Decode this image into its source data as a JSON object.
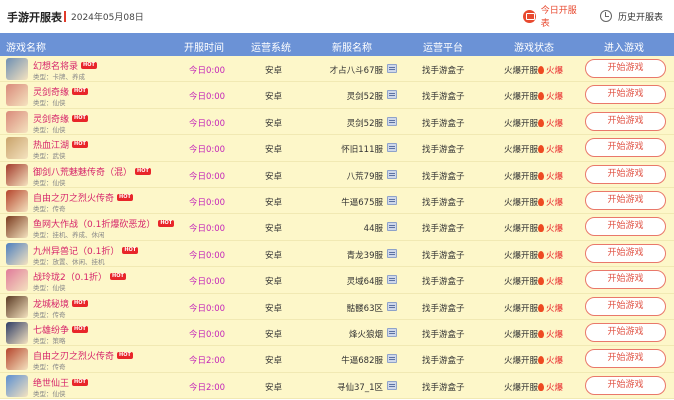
{
  "header": {
    "title": "手游开服表",
    "date": "2024年05月08日",
    "today_label": "今日开服表",
    "history_label": "历史开服表",
    "today_icon": "calendar-icon",
    "history_icon": "clock-icon"
  },
  "columns": [
    "游戏名称",
    "开服时间",
    "运营系统",
    "新服名称",
    "运营平台",
    "游戏状态",
    "进入游戏"
  ],
  "colors": {
    "accent": "#e8492f",
    "header_bg": "#6b92d6",
    "row_bg": "#fdf7c9",
    "name": "#d6246a",
    "time": "#c426b8"
  },
  "hot_badge": "HOT",
  "play_label": "开始游戏",
  "rows": [
    {
      "name": "幻想名将录",
      "type": "类型：卡牌、养成",
      "time": "今日0:00",
      "os": "安卓",
      "server": "才占八斗67服",
      "platform": "找手游盒子",
      "status": "火爆开服",
      "heat": "火爆",
      "thumb": "#6d8fb3"
    },
    {
      "name": "灵剑奇缘",
      "type": "类型：仙侠",
      "time": "今日0:00",
      "os": "安卓",
      "server": "灵剑52服",
      "platform": "找手游盒子",
      "status": "火爆开服",
      "heat": "火爆",
      "thumb": "#d98a7a"
    },
    {
      "name": "灵剑奇缘",
      "type": "类型：仙侠",
      "time": "今日0:00",
      "os": "安卓",
      "server": "灵剑52服",
      "platform": "找手游盒子",
      "status": "火爆开服",
      "heat": "火爆",
      "thumb": "#d98a7a"
    },
    {
      "name": "热血江湖",
      "type": "类型：武侠",
      "time": "今日0:00",
      "os": "安卓",
      "server": "怀旧111服",
      "platform": "找手游盒子",
      "status": "火爆开服",
      "heat": "火爆",
      "thumb": "#c9a36b"
    },
    {
      "name": "御剑八荒魅魅传奇（混）",
      "type": "类型：仙侠",
      "time": "今日0:00",
      "os": "安卓",
      "server": "八荒79服",
      "platform": "找手游盒子",
      "status": "火爆开服",
      "heat": "火爆",
      "thumb": "#a33b2c"
    },
    {
      "name": "自由之刃之烈火传奇",
      "type": "类型：传奇",
      "time": "今日0:00",
      "os": "安卓",
      "server": "牛逼675服",
      "platform": "找手游盒子",
      "status": "火爆开服",
      "heat": "火爆",
      "thumb": "#b5452c"
    },
    {
      "name": "鱼网大作战（0.1折爆砍恶龙）",
      "type": "类型：挂机、养成、休闲",
      "time": "今日0:00",
      "os": "安卓",
      "server": "44服",
      "platform": "找手游盒子",
      "status": "火爆开服",
      "heat": "火爆",
      "thumb": "#7a3b1f"
    },
    {
      "name": "九州异兽记（0.1折）",
      "type": "类型：放置、休闲、挂机",
      "time": "今日0:00",
      "os": "安卓",
      "server": "青龙39服",
      "platform": "找手游盒子",
      "status": "火爆开服",
      "heat": "火爆",
      "thumb": "#4c7fbf"
    },
    {
      "name": "战玲珑2（0.1折）",
      "type": "类型：仙侠",
      "time": "今日0:00",
      "os": "安卓",
      "server": "灵域64服",
      "platform": "找手游盒子",
      "status": "火爆开服",
      "heat": "火爆",
      "thumb": "#e07a9a"
    },
    {
      "name": "龙城秘境",
      "type": "类型：传奇",
      "time": "今日0:00",
      "os": "安卓",
      "server": "骷髅63区",
      "platform": "找手游盒子",
      "status": "火爆开服",
      "heat": "火爆",
      "thumb": "#5a3a24"
    },
    {
      "name": "七雄纷争",
      "type": "类型：策略",
      "time": "今日0:00",
      "os": "安卓",
      "server": "烽火狼烟",
      "platform": "找手游盒子",
      "status": "火爆开服",
      "heat": "火爆",
      "thumb": "#2e3d66"
    },
    {
      "name": "自由之刃之烈火传奇",
      "type": "类型：传奇",
      "time": "今日2:00",
      "os": "安卓",
      "server": "牛逼682服",
      "platform": "找手游盒子",
      "status": "火爆开服",
      "heat": "火爆",
      "thumb": "#b5452c"
    },
    {
      "name": "绝世仙王",
      "type": "类型：仙侠",
      "time": "今日2:00",
      "os": "安卓",
      "server": "寻仙37_1区",
      "platform": "找手游盒子",
      "status": "火爆开服",
      "heat": "火爆",
      "thumb": "#5b8fd1"
    }
  ]
}
